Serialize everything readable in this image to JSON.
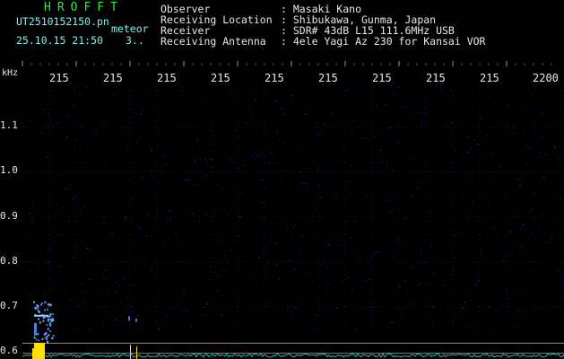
{
  "header": {
    "app_title": "HROFFT",
    "file_name": "UT2510152150.pn",
    "event_type": "meteor",
    "datetime": "25.10.15 21:50",
    "count": "3..",
    "info": [
      {
        "label": "Observer",
        "value": ": Masaki Kano"
      },
      {
        "label": "Receiving Location",
        "value": ": Shibukawa, Gunma, Japan"
      },
      {
        "label": "Receiver",
        "value": ": SDR# 43dB L15 111.6MHz USB"
      },
      {
        "label": "Receiving Antenna",
        "value": ": 4ele Yagi Az 230 for Kansai VOR"
      }
    ]
  },
  "chart_data": {
    "type": "heatmap",
    "xlabel": "",
    "ylabel": "kHz",
    "x_tick_labels": [
      "215",
      "215",
      "215",
      "215",
      "215",
      "215",
      "215",
      "215",
      "215",
      "2200"
    ],
    "y_tick_labels": [
      "1.1",
      "1.0",
      "0.9",
      "0.8",
      "0.7",
      "0.6"
    ],
    "y_ticks_khz": [
      1.1,
      1.0,
      0.9,
      0.8,
      0.7,
      0.6
    ],
    "ylim": [
      0.585,
      1.19
    ],
    "colors": {
      "background": "#000000",
      "grid": "#1a1a6e",
      "noise": "#1c1c8a",
      "echo": "#3a78d8",
      "echo_bright": "#ffe000",
      "reference_line": "#c8c8d8",
      "level_trace": "#2ad6d6"
    }
  }
}
